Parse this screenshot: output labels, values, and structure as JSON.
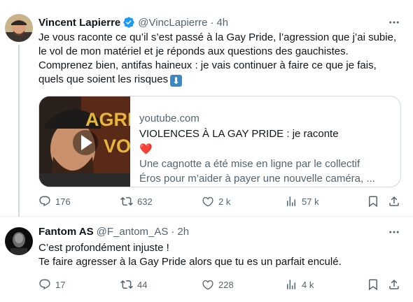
{
  "tweets": [
    {
      "name": "Vincent Lapierre",
      "verified": true,
      "handle": "@VincLapierre",
      "separator": "·",
      "time": "4h",
      "text_lines": [
        "Je vous raconte ce qu’il s’est passé à la Gay Pride, l’agression que j’ai subie,",
        "le vol de mon matériel et je réponds aux questions des gauchistes.",
        "Comprenez bien, antifas haineux : je vais continuer à faire ce que je fais,",
        "quels que soient les risques"
      ],
      "emoji": "⬇",
      "card": {
        "domain": "youtube.com",
        "title": "VIOLENCES À LA GAY PRIDE : je raconte",
        "desc_emoji": "❤️",
        "desc_line1": " Une cagnotte a été mise en ligne par le collectif",
        "desc_line2": "Éros pour m’aider à payer une nouvelle caméra, ...",
        "thumb_text_top": "AGRE",
        "thumb_text_bottom": "VOI"
      },
      "stats": {
        "replies": "176",
        "retweets": "632",
        "likes": "2 k",
        "views": "57 k"
      }
    },
    {
      "name": "Fantom AS",
      "handle": "@F_antom_AS",
      "separator": "·",
      "time": "2h",
      "text_lines": [
        "C’est profondément injuste !",
        "Te faire agresser à la Gay Pride alors que tu es un parfait enculé."
      ],
      "stats": {
        "replies": "17",
        "retweets": "44",
        "likes": "228",
        "views": "4 k"
      }
    }
  ],
  "colors": {
    "text_primary": "#0f1419",
    "text_secondary": "#536471",
    "verified_blue": "#1d9bf0",
    "border": "#cfd9de"
  }
}
